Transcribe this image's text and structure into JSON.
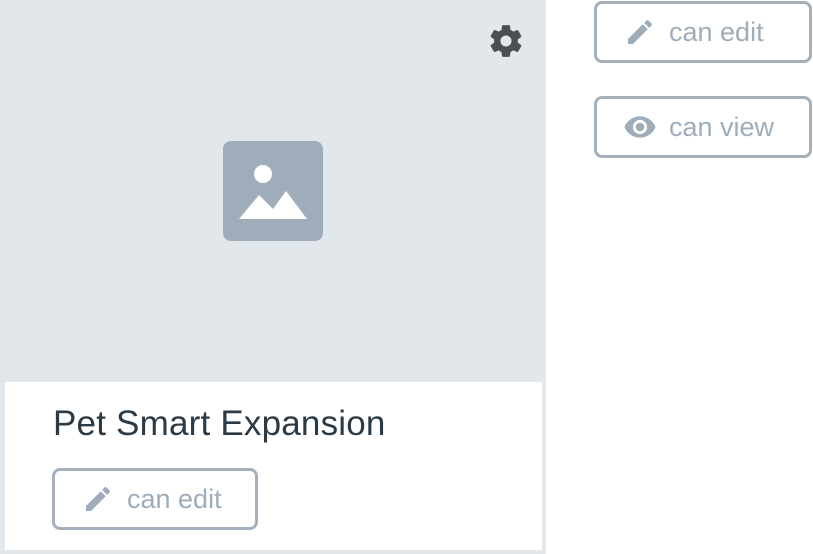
{
  "card": {
    "title": "Pet Smart Expansion",
    "thumbnail_icon": "image-placeholder-icon",
    "settings_icon": "gear-icon",
    "permission_label": "can edit",
    "permission_icon": "pencil-icon"
  },
  "side_buttons": [
    {
      "label": "can edit",
      "icon": "pencil-icon"
    },
    {
      "label": "can view",
      "icon": "eye-icon"
    }
  ],
  "colors": {
    "card_background": "#e2e7ec",
    "placeholder": "#9eadb9",
    "title_text": "#2b3a45",
    "button_border": "#a4b0bc",
    "button_text": "#9eadb9",
    "gear": "#4a4f54"
  }
}
